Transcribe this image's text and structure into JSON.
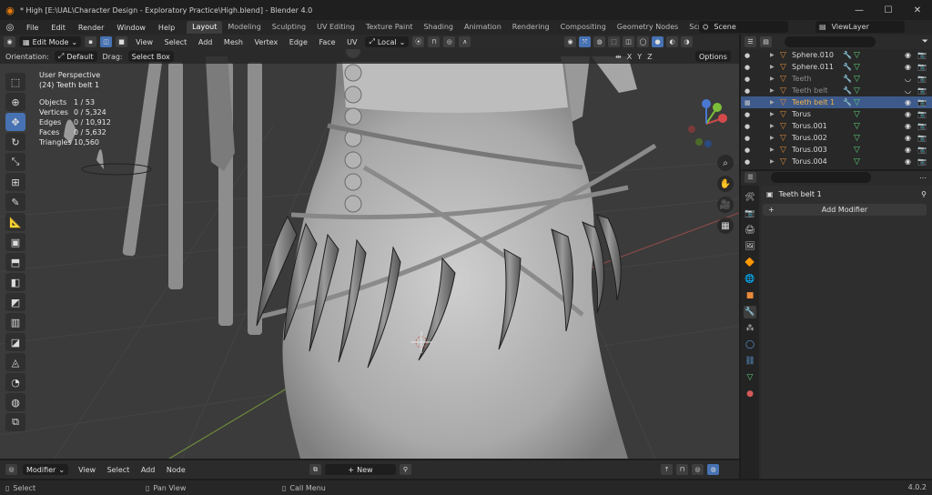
{
  "window": {
    "title": "* High [E:\\UAL\\Character Design - Exploratory Practice\\High.blend] - Blender 4.0",
    "min": "—",
    "max": "☐",
    "close": "✕"
  },
  "menu": [
    "File",
    "Edit",
    "Render",
    "Window",
    "Help"
  ],
  "workspaces": [
    {
      "label": "Layout",
      "active": true
    },
    {
      "label": "Modeling"
    },
    {
      "label": "Sculpting"
    },
    {
      "label": "UV Editing"
    },
    {
      "label": "Texture Paint"
    },
    {
      "label": "Shading"
    },
    {
      "label": "Animation"
    },
    {
      "label": "Rendering"
    },
    {
      "label": "Compositing"
    },
    {
      "label": "Geometry Nodes"
    },
    {
      "label": "Scripting"
    }
  ],
  "add_workspace": "+",
  "scene": "Scene",
  "view_layer": "ViewLayer",
  "viewport": {
    "mode": "Edit Mode",
    "menu": [
      "View",
      "Select",
      "Add",
      "Mesh",
      "Vertex",
      "Edge",
      "Face",
      "UV"
    ],
    "transform": "Local",
    "orientation_label": "Orientation:",
    "orientation": "Default",
    "drag_label": "Drag:",
    "drag": "Select Box",
    "options": "Options",
    "axes": [
      "X",
      "Y",
      "Z"
    ]
  },
  "stats": {
    "view": "User Perspective",
    "object": "(24) Teeth belt 1",
    "rows": [
      {
        "k": "Objects",
        "v": "1 / 53"
      },
      {
        "k": "Vertices",
        "v": "0 / 5,324"
      },
      {
        "k": "Edges",
        "v": "0 / 10,912"
      },
      {
        "k": "Faces",
        "v": "0 / 5,632"
      },
      {
        "k": "Triangles",
        "v": "10,560"
      }
    ]
  },
  "outliner": {
    "rows": [
      {
        "name": "Sphere.010",
        "mod": true
      },
      {
        "name": "Sphere.011",
        "mod": true
      },
      {
        "name": "Teeth",
        "dim": true,
        "mod": true
      },
      {
        "name": "Teeth belt",
        "dim": true,
        "mod": true
      },
      {
        "name": "Teeth belt 1",
        "selected": true,
        "mod": true
      },
      {
        "name": "Torus"
      },
      {
        "name": "Torus.001"
      },
      {
        "name": "Torus.002"
      },
      {
        "name": "Torus.003"
      },
      {
        "name": "Torus.004"
      }
    ]
  },
  "properties": {
    "object_name": "Teeth belt 1",
    "add_modifier": "Add Modifier"
  },
  "timeline": {
    "editor": "Modifier",
    "menu": [
      "View",
      "Select",
      "Add",
      "Node"
    ],
    "new": "New"
  },
  "status": {
    "select": "Select",
    "pan": "Pan View",
    "call": "Call Menu",
    "version": "4.0.2"
  },
  "colors": {
    "accent": "#4772b3",
    "selected_object": "#e8a33b",
    "mesh_icon": "#5ccf7a"
  }
}
